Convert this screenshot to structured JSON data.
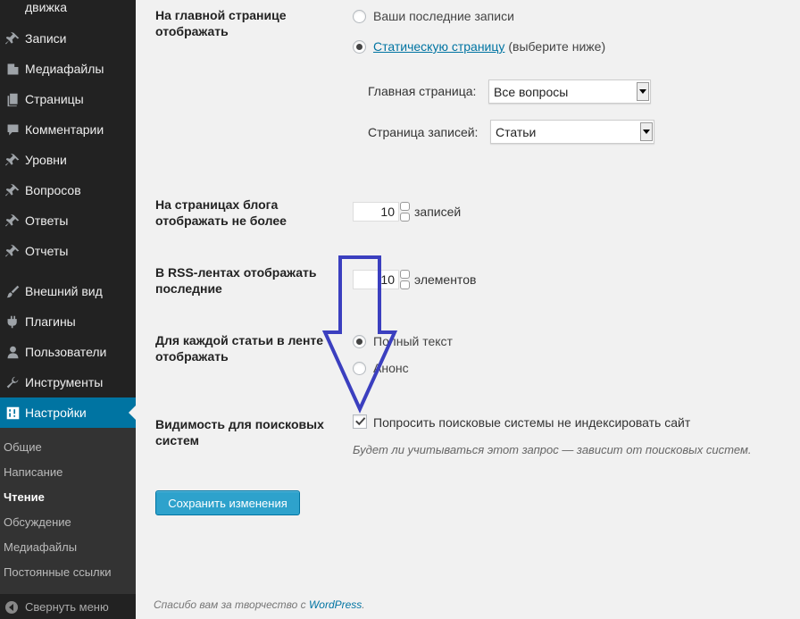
{
  "sidebar": {
    "top_partial": "движка",
    "items": [
      {
        "label": "Записи",
        "icon": "pin-icon"
      },
      {
        "label": "Медиафайлы",
        "icon": "media-icon"
      },
      {
        "label": "Страницы",
        "icon": "pages-icon"
      },
      {
        "label": "Комментарии",
        "icon": "comments-icon"
      },
      {
        "label": "Уровни",
        "icon": "pin-icon"
      },
      {
        "label": "Вопросов",
        "icon": "pin-icon"
      },
      {
        "label": "Ответы",
        "icon": "pin-icon"
      },
      {
        "label": "Отчеты",
        "icon": "pin-icon"
      },
      {
        "label": "Внешний вид",
        "icon": "brush-icon"
      },
      {
        "label": "Плагины",
        "icon": "plugin-icon"
      },
      {
        "label": "Пользователи",
        "icon": "users-icon"
      },
      {
        "label": "Инструменты",
        "icon": "wrench-icon"
      },
      {
        "label": "Настройки",
        "icon": "settings-icon",
        "active": true
      }
    ],
    "submenu": [
      "Общие",
      "Написание",
      "Чтение",
      "Обсуждение",
      "Медиафайлы",
      "Постоянные ссылки"
    ],
    "submenu_current": "Чтение",
    "collapse_label": "Свернуть меню"
  },
  "settings": {
    "front_page": {
      "label": "На главной странице отображать",
      "option_latest": "Ваши последние записи",
      "option_static_link": "Статическую страницу",
      "option_static_hint": "(выберите ниже)",
      "selected": "static",
      "homepage_label": "Главная страница:",
      "homepage_value": "Все вопросы",
      "posts_page_label": "Страница записей:",
      "posts_page_value": "Статьи"
    },
    "blog_pages": {
      "label": "На страницах блога отображать не более",
      "value": "10",
      "unit": "записей"
    },
    "rss": {
      "label": "В RSS-лентах отображать последние",
      "value": "10",
      "unit": "элементов"
    },
    "feed_content": {
      "label": "Для каждой статьи в ленте отображать",
      "option_full": "Полный текст",
      "option_summary": "Анонс",
      "selected": "full"
    },
    "visibility": {
      "label": "Видимость для поисковых систем",
      "checkbox_label": "Попросить поисковые системы не индексировать сайт",
      "checked": true,
      "description": "Будет ли учитываться этот запрос — зависит от поисковых систем."
    },
    "save_label": "Сохранить изменения"
  },
  "footer": {
    "text": "Спасибо вам за творчество с ",
    "link": "WordPress",
    "suffix": "."
  },
  "colors": {
    "sidebar_bg": "#222222",
    "active_bg": "#0074a2",
    "button_bg": "#2ea2cc",
    "arrow_stroke": "#3b3fbf"
  }
}
